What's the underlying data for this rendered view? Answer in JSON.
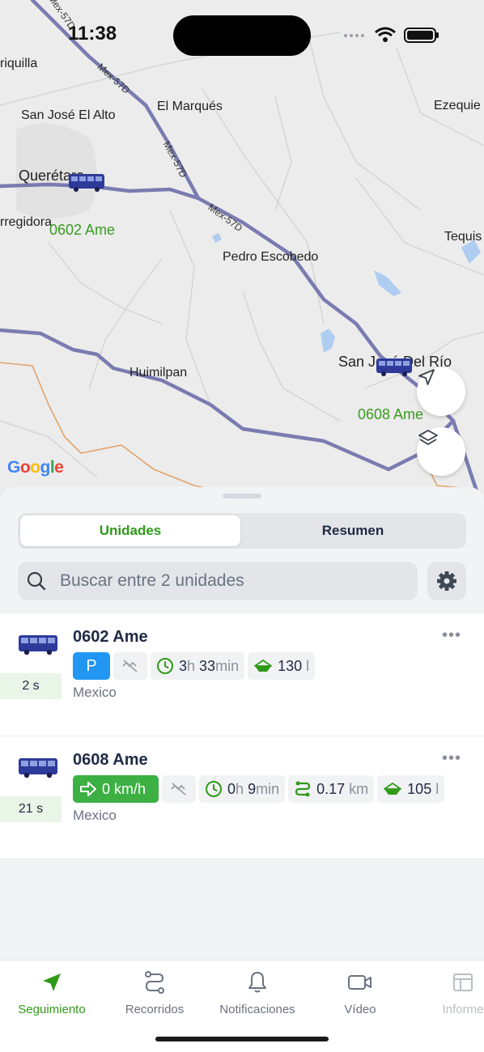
{
  "status_bar": {
    "time": "11:38"
  },
  "map": {
    "places": [
      "riquilla",
      "San José El Alto",
      "El Marqués",
      "Ezequie",
      "Querétaro",
      "rregidora",
      "Pedro Escobedo",
      "Tequis",
      "Huimilpan",
      "San José Del Río"
    ],
    "roads": [
      "Mex-57D",
      "Mex-57D",
      "Mex-57D",
      "Mex-57D"
    ],
    "unit_labels": [
      "0602 Ame",
      "0608 Ame"
    ],
    "logo": "Google"
  },
  "segments": {
    "active": "Unidades",
    "inactive": "Resumen"
  },
  "search": {
    "placeholder": "Buscar entre 2 unidades"
  },
  "units": [
    {
      "name": "0602 Ame",
      "age": "2 s",
      "status": "P",
      "duration_h": "3",
      "duration_h_unit": "h",
      "duration_m": "33",
      "duration_m_unit": "min",
      "fuel": "130",
      "fuel_unit": "l",
      "location": "Mexico"
    },
    {
      "name": "0608 Ame",
      "age": "21 s",
      "speed": "0 km/h",
      "duration_h": "0",
      "duration_h_unit": "h",
      "duration_m": "9",
      "duration_m_unit": "min",
      "distance": "0.17",
      "distance_unit": "km",
      "fuel": "105",
      "fuel_unit": "l",
      "location": "Mexico"
    }
  ],
  "tabs": [
    {
      "label": "Seguimiento",
      "icon": "navigation-arrow-icon",
      "active": true
    },
    {
      "label": "Recorridos",
      "icon": "route-icon"
    },
    {
      "label": "Notificaciones",
      "icon": "bell-icon"
    },
    {
      "label": "Vídeo",
      "icon": "video-camera-icon"
    },
    {
      "label": "Informe",
      "icon": "table-icon"
    }
  ],
  "colors": {
    "accent_green": "#2f9a18",
    "route": "#6e6fa8",
    "bus": "#2d3a9a",
    "parked_blue": "#2196f3",
    "moving_green": "#3cb043"
  }
}
